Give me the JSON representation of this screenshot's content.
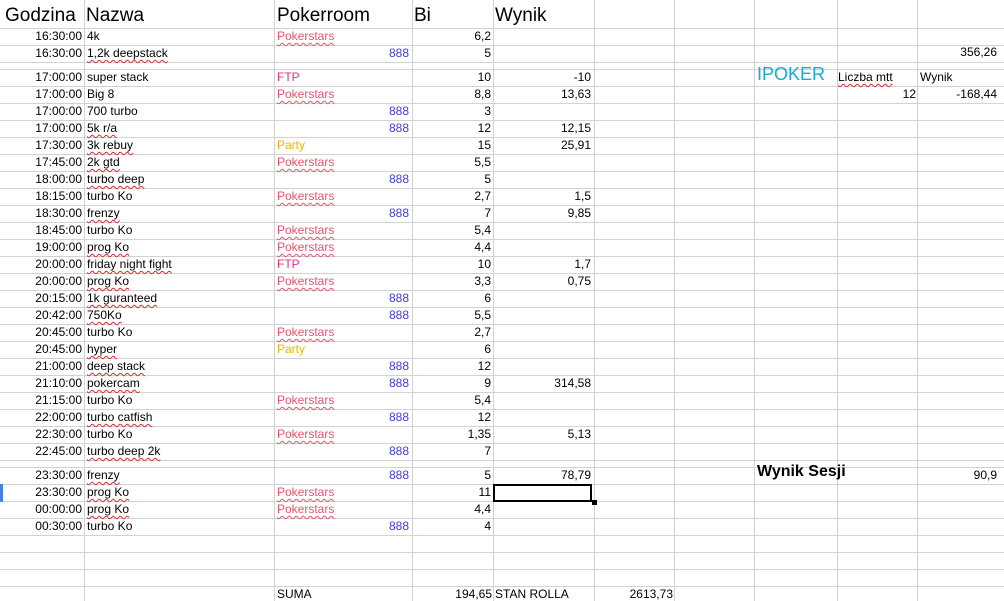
{
  "headers": {
    "time": "Godzina",
    "name": "Nazwa",
    "room": "Pokerroom",
    "bi": "Bi",
    "result": "Wynik"
  },
  "rows": [
    {
      "time": "16:30:00",
      "name": "4k",
      "room": "Pokerstars",
      "bi": "6,2",
      "result": ""
    },
    {
      "time": "16:30:00",
      "name": "1,2k deepstack",
      "room": "888",
      "bi": "5",
      "result": ""
    },
    {
      "time": "17:00:00",
      "name": "super stack",
      "room": "FTP",
      "bi": "10",
      "result": "-10"
    },
    {
      "time": "17:00:00",
      "name": "Big 8",
      "room": "Pokerstars",
      "bi": "8,8",
      "result": "13,63"
    },
    {
      "time": "17:00:00",
      "name": "700 turbo",
      "room": "888",
      "bi": "3",
      "result": ""
    },
    {
      "time": "17:00:00",
      "name": "5k r/a",
      "room": "888",
      "bi": "12",
      "result": "12,15"
    },
    {
      "time": "17:30:00",
      "name": "3k rebuy",
      "room": "Party",
      "bi": "15",
      "result": "25,91"
    },
    {
      "time": "17:45:00",
      "name": "2k gtd",
      "room": "Pokerstars",
      "bi": "5,5",
      "result": ""
    },
    {
      "time": "18:00:00",
      "name": "turbo deep",
      "room": "888",
      "bi": "5",
      "result": ""
    },
    {
      "time": "18:15:00",
      "name": "turbo Ko",
      "room": "Pokerstars",
      "bi": "2,7",
      "result": "1,5"
    },
    {
      "time": "18:30:00",
      "name": "frenzy",
      "room": "888",
      "bi": "7",
      "result": "9,85"
    },
    {
      "time": "18:45:00",
      "name": "turbo Ko",
      "room": "Pokerstars",
      "bi": "5,4",
      "result": ""
    },
    {
      "time": "19:00:00",
      "name": "prog Ko",
      "room": "Pokerstars",
      "bi": "4,4",
      "result": ""
    },
    {
      "time": "20:00:00",
      "name": "friday night fight",
      "room": "FTP",
      "bi": "10",
      "result": "1,7"
    },
    {
      "time": "20:00:00",
      "name": "prog Ko",
      "room": "Pokerstars",
      "bi": "3,3",
      "result": "0,75"
    },
    {
      "time": "20:15:00",
      "name": "1k guranteed",
      "room": "888",
      "bi": "6",
      "result": ""
    },
    {
      "time": "20:42:00",
      "name": "750Ko",
      "room": "888",
      "bi": "5,5",
      "result": ""
    },
    {
      "time": "20:45:00",
      "name": "turbo Ko",
      "room": "Pokerstars",
      "bi": "2,7",
      "result": ""
    },
    {
      "time": "20:45:00",
      "name": "hyper",
      "room": "Party",
      "bi": "6",
      "result": ""
    },
    {
      "time": "21:00:00",
      "name": "deep stack",
      "room": "888",
      "bi": "12",
      "result": ""
    },
    {
      "time": "21:10:00",
      "name": "pokercam",
      "room": "888",
      "bi": "9",
      "result": "314,58"
    },
    {
      "time": "21:15:00",
      "name": "turbo Ko",
      "room": "Pokerstars",
      "bi": "5,4",
      "result": ""
    },
    {
      "time": "22:00:00",
      "name": "turbo catfish",
      "room": "888",
      "bi": "12",
      "result": ""
    },
    {
      "time": "22:30:00",
      "name": "turbo Ko",
      "room": "Pokerstars",
      "bi": "1,35",
      "result": "5,13"
    },
    {
      "time": "22:45:00",
      "name": "turbo deep 2k",
      "room": "888",
      "bi": "7",
      "result": ""
    },
    {
      "time": "23:30:00",
      "name": "frenzy",
      "room": "888",
      "bi": "5",
      "result": "78,79"
    },
    {
      "time": "23:30:00",
      "name": "prog Ko",
      "room": "Pokerstars",
      "bi": "11",
      "result": ""
    },
    {
      "time": "00:00:00",
      "name": "prog Ko",
      "room": "Pokerstars",
      "bi": "4,4",
      "result": ""
    },
    {
      "time": "00:30:00",
      "name": "turbo Ko",
      "room": "888",
      "bi": "4",
      "result": ""
    }
  ],
  "side": {
    "top_value": "356,26",
    "ipoker_label": "IPOKER",
    "mtt_label": "Liczba mtt",
    "result_label": "Wynik",
    "mtt_count": "12",
    "ipoker_result": "-168,44",
    "session_label": "Wynik Sesji",
    "session_value": "90,9"
  },
  "footer": {
    "sum_label": "SUMA",
    "sum_value": "194,65",
    "roll_label": "STAN ROLLA",
    "roll_value": "2613,73"
  },
  "colors": {
    "pokerstars": "#e0566e",
    "888": "#3f3fd4",
    "ftp": "#e03080",
    "party": "#e8b600",
    "ipoker": "#1aa9c9"
  }
}
